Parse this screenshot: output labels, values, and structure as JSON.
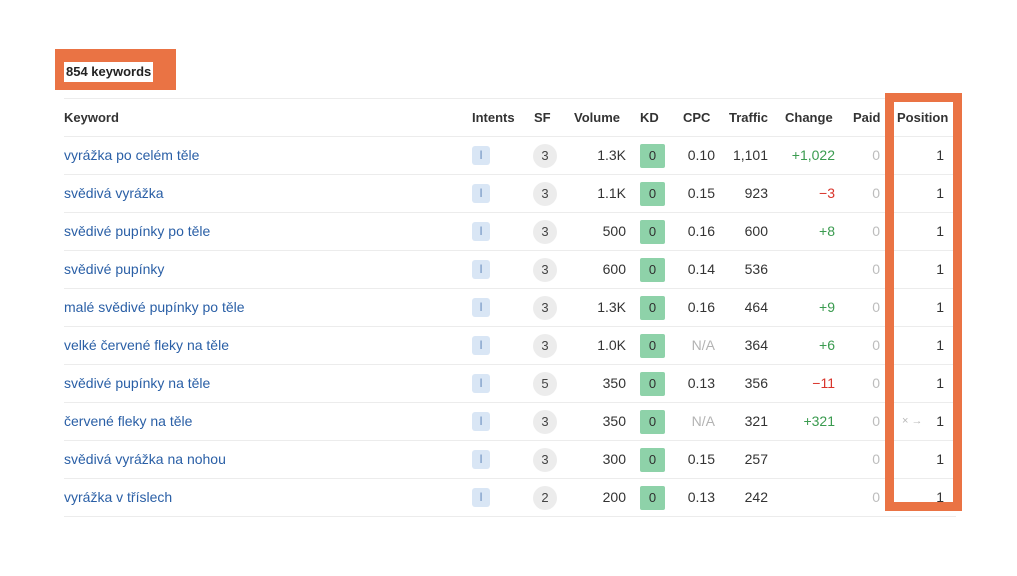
{
  "header": {
    "count_label": "854 keywords"
  },
  "columns": {
    "keyword": "Keyword",
    "intents": "Intents",
    "sf": "SF",
    "volume": "Volume",
    "kd": "KD",
    "cpc": "CPC",
    "traffic": "Traffic",
    "change": "Change",
    "paid": "Paid",
    "position": "Position"
  },
  "rows": [
    {
      "keyword": "vyrážka po celém těle",
      "intent": "I",
      "sf": "3",
      "volume": "1.3K",
      "kd": "0",
      "cpc": "0.10",
      "traffic": "1,101",
      "change": "+1,022",
      "paid": "0",
      "position": "1",
      "position_prefix": ""
    },
    {
      "keyword": "svědivá vyrážka",
      "intent": "I",
      "sf": "3",
      "volume": "1.1K",
      "kd": "0",
      "cpc": "0.15",
      "traffic": "923",
      "change": "−3",
      "paid": "0",
      "position": "1",
      "position_prefix": ""
    },
    {
      "keyword": "svědivé pupínky po těle",
      "intent": "I",
      "sf": "3",
      "volume": "500",
      "kd": "0",
      "cpc": "0.16",
      "traffic": "600",
      "change": "+8",
      "paid": "0",
      "position": "1",
      "position_prefix": ""
    },
    {
      "keyword": "svědivé pupínky",
      "intent": "I",
      "sf": "3",
      "volume": "600",
      "kd": "0",
      "cpc": "0.14",
      "traffic": "536",
      "change": "",
      "paid": "0",
      "position": "1",
      "position_prefix": ""
    },
    {
      "keyword": "malé svědivé pupínky po těle",
      "intent": "I",
      "sf": "3",
      "volume": "1.3K",
      "kd": "0",
      "cpc": "0.16",
      "traffic": "464",
      "change": "+9",
      "paid": "0",
      "position": "1",
      "position_prefix": ""
    },
    {
      "keyword": "velké červené fleky na těle",
      "intent": "I",
      "sf": "3",
      "volume": "1.0K",
      "kd": "0",
      "cpc": "N/A",
      "traffic": "364",
      "change": "+6",
      "paid": "0",
      "position": "1",
      "position_prefix": ""
    },
    {
      "keyword": "svědivé pupínky na těle",
      "intent": "I",
      "sf": "5",
      "volume": "350",
      "kd": "0",
      "cpc": "0.13",
      "traffic": "356",
      "change": "−11",
      "paid": "0",
      "position": "1",
      "position_prefix": ""
    },
    {
      "keyword": "červené fleky na těle",
      "intent": "I",
      "sf": "3",
      "volume": "350",
      "kd": "0",
      "cpc": "N/A",
      "traffic": "321",
      "change": "+321",
      "paid": "0",
      "position": "1",
      "position_prefix": "× →"
    },
    {
      "keyword": "svědivá vyrážka na nohou",
      "intent": "I",
      "sf": "3",
      "volume": "300",
      "kd": "0",
      "cpc": "0.15",
      "traffic": "257",
      "change": "",
      "paid": "0",
      "position": "1",
      "position_prefix": ""
    },
    {
      "keyword": "vyrážka v tříslech",
      "intent": "I",
      "sf": "2",
      "volume": "200",
      "kd": "0",
      "cpc": "0.13",
      "traffic": "242",
      "change": "",
      "paid": "0",
      "position": "1",
      "position_prefix": ""
    }
  ],
  "colors": {
    "highlight": "#ea7344",
    "link": "#2a5fa6",
    "kd_easy": "#8ed2a9",
    "positive_change": "#3a9b4f",
    "negative_change": "#d9342b"
  }
}
